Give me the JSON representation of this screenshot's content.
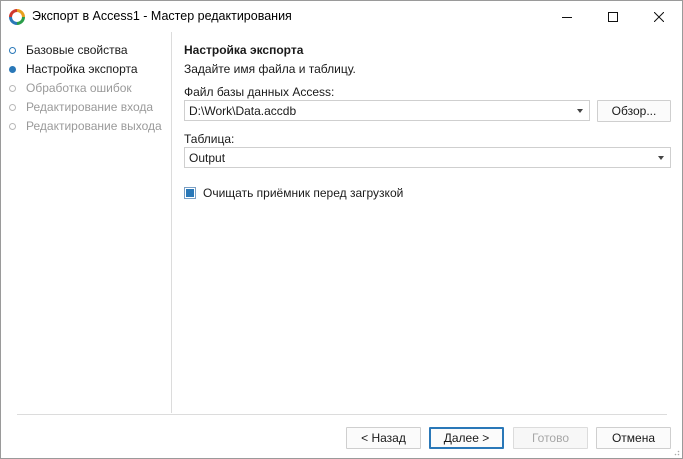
{
  "window": {
    "title": "Экспорт в Access1 - Мастер редактирования"
  },
  "steps": [
    {
      "label": "Базовые свойства",
      "state": "done"
    },
    {
      "label": "Настройка экспорта",
      "state": "current"
    },
    {
      "label": "Обработка ошибок",
      "state": "pending"
    },
    {
      "label": "Редактирование входа",
      "state": "pending"
    },
    {
      "label": "Редактирование выхода",
      "state": "pending"
    }
  ],
  "content": {
    "heading": "Настройка экспорта",
    "subheading": "Задайте имя файла и таблицу.",
    "db_file_label": "Файл базы данных Access:",
    "db_file_value": "D:\\Work\\Data.accdb",
    "browse_label": "Обзор...",
    "table_label": "Таблица:",
    "table_value": "Output",
    "clear_receiver_label": "Очищать приёмник перед загрузкой",
    "clear_receiver_checked": true
  },
  "footer": {
    "back_label": "< Назад",
    "next_label": "Далее >",
    "finish_label": "Готово",
    "cancel_label": "Отмена"
  },
  "colors": {
    "accent": "#2a78b8",
    "disabled_text": "#a6a6a6"
  }
}
